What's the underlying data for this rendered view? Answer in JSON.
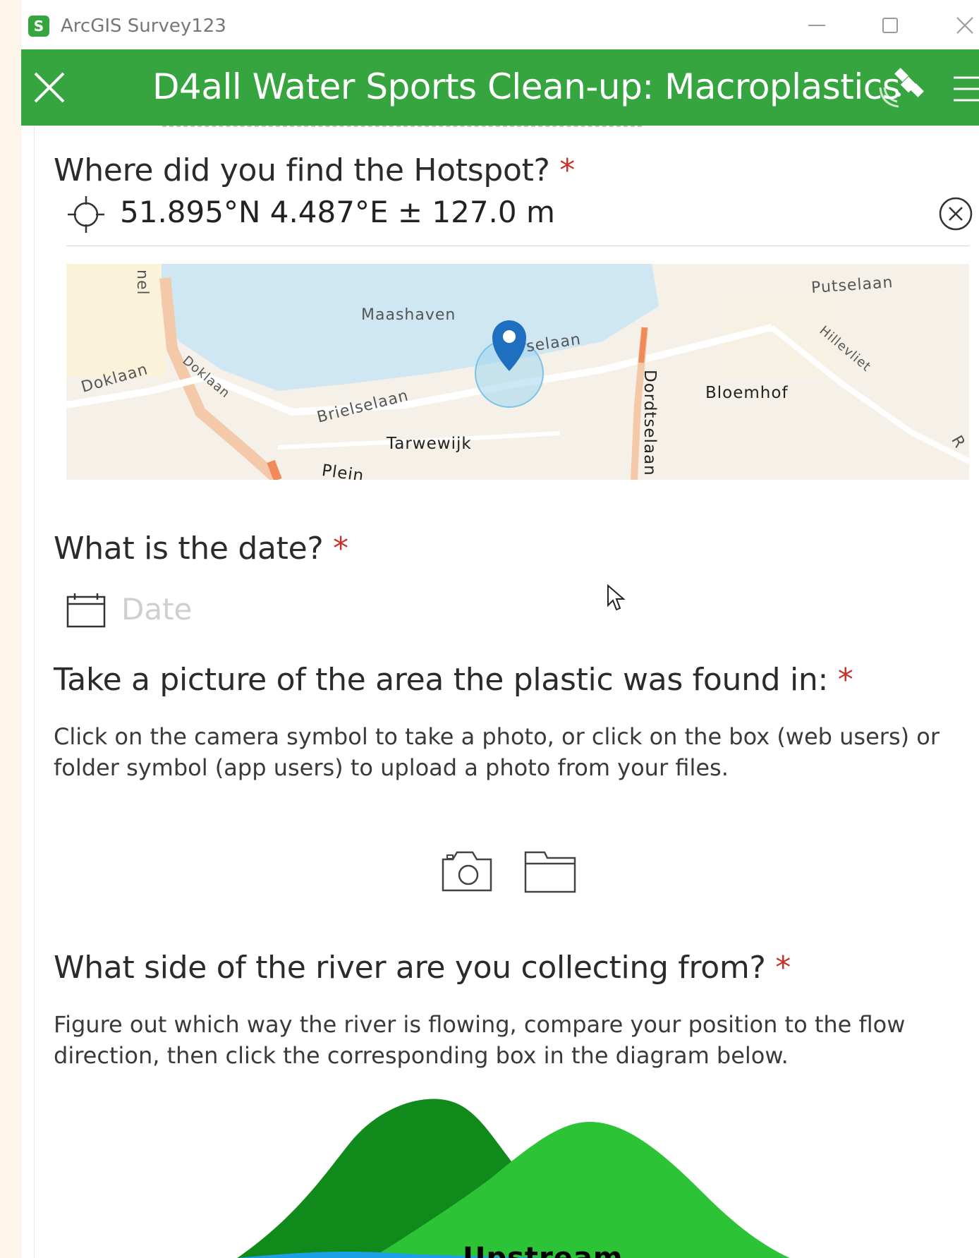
{
  "window": {
    "app_title": "ArcGIS Survey123",
    "app_icon_letter": "S"
  },
  "header": {
    "title": "D4all Water Sports Clean-up: Macroplastics"
  },
  "questions": {
    "location": {
      "label": "Where did you find the Hotspot?",
      "required_mark": "*",
      "coordinates": "51.895°N 4.487°E ± 127.0 m"
    },
    "map": {
      "labels": {
        "nel": "nel",
        "maashaven": "Maashaven",
        "selaan": "selaan",
        "putselaan": "Putselaan",
        "hilleviiet": "Hillevliet",
        "doklaan1": "Doklaan",
        "doklaan2": "Doklaan",
        "brielselaan": "Brielselaan",
        "bloemhof": "Bloemhof",
        "dordtselaan": "Dordtselaan",
        "tarwewijk": "Tarwewijk",
        "plein": "Plein",
        "r": "R"
      }
    },
    "date": {
      "label": "What is the date?",
      "required_mark": "*",
      "placeholder": "Date"
    },
    "picture": {
      "label": "Take a picture of the area the plastic was found in:",
      "required_mark": "*",
      "hint": "Click on the camera symbol to take a photo, or click on the box (web users) or folder symbol (app users) to upload a photo from your files."
    },
    "river_side": {
      "label": "What side of the river are you collecting from?",
      "required_mark": "*",
      "hint": "Figure out which way the river is flowing, compare your position to the flow direction, then click the corresponding box in the diagram below.",
      "diagram_label": "Upstream"
    }
  },
  "colors": {
    "brand_green": "#36a43f",
    "required_red": "#c8312a",
    "pin_blue": "#1f6fc0"
  },
  "icons": {
    "close": "close-icon",
    "satellite": "satellite-icon",
    "menu": "menu-icon",
    "crosshair": "crosshair-icon",
    "clear": "clear-circle-icon",
    "calendar": "calendar-icon",
    "camera": "camera-icon",
    "folder": "folder-icon",
    "pin": "map-pin-icon"
  }
}
